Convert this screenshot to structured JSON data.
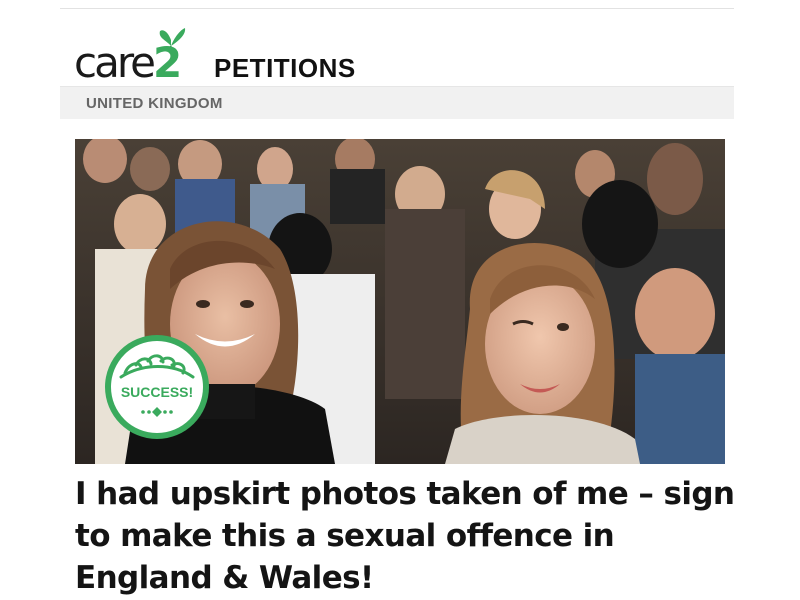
{
  "brand": {
    "logo_text": "care",
    "logo_number": "2",
    "section_label": "PETITIONS",
    "accent_color": "#3aaa5d",
    "logo_icon": "butterfly-icon"
  },
  "region": {
    "label": "UNITED KINGDOM"
  },
  "hero": {
    "image_kind": "crowd photo of two women smiling",
    "badge_text": "SUCCESS!",
    "badge_icon": "laurel-icon"
  },
  "petition": {
    "title": "I had upskirt photos taken of me – sign to make this a sexual offence in England & Wales!"
  }
}
